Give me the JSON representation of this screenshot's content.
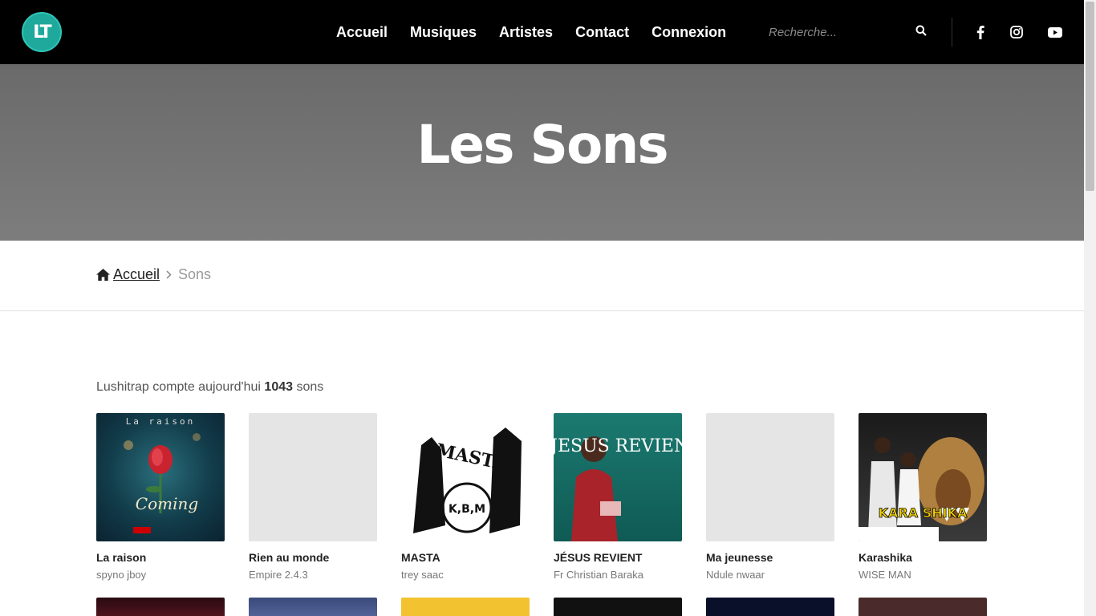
{
  "header": {
    "logo_text": "LT",
    "nav": [
      {
        "label": "Accueil"
      },
      {
        "label": "Musiques"
      },
      {
        "label": "Artistes"
      },
      {
        "label": "Contact"
      },
      {
        "label": "Connexion"
      }
    ],
    "search_placeholder": "Recherche...",
    "social_icons": [
      "facebook-icon",
      "instagram-icon",
      "youtube-icon"
    ]
  },
  "hero": {
    "title": "Les Sons"
  },
  "breadcrumb": {
    "home": "Accueil",
    "current": "Sons"
  },
  "stats": {
    "prefix": "Lushitrap compte aujourd'hui",
    "count": "1043",
    "suffix": "sons"
  },
  "songs": [
    {
      "title": "La raison",
      "artist": "spyno jboy",
      "cover_text": "La raison"
    },
    {
      "title": "Rien au monde",
      "artist": "Empire 2.4.3",
      "cover_text": ""
    },
    {
      "title": "MASTA",
      "artist": "trey saac",
      "cover_text": "MASTA"
    },
    {
      "title": "JÉSUS REVIENT",
      "artist": "Fr Christian Baraka",
      "cover_text": "JESUS REVIENT"
    },
    {
      "title": "Ma jeunesse",
      "artist": "Ndule nwaar",
      "cover_text": ""
    },
    {
      "title": "Karashika",
      "artist": "WISE MAN",
      "cover_text": "KARA SHIKA"
    }
  ],
  "colors": {
    "accent": "#1fa89c",
    "header_bg": "#000000",
    "hero_bg": "#757575"
  }
}
